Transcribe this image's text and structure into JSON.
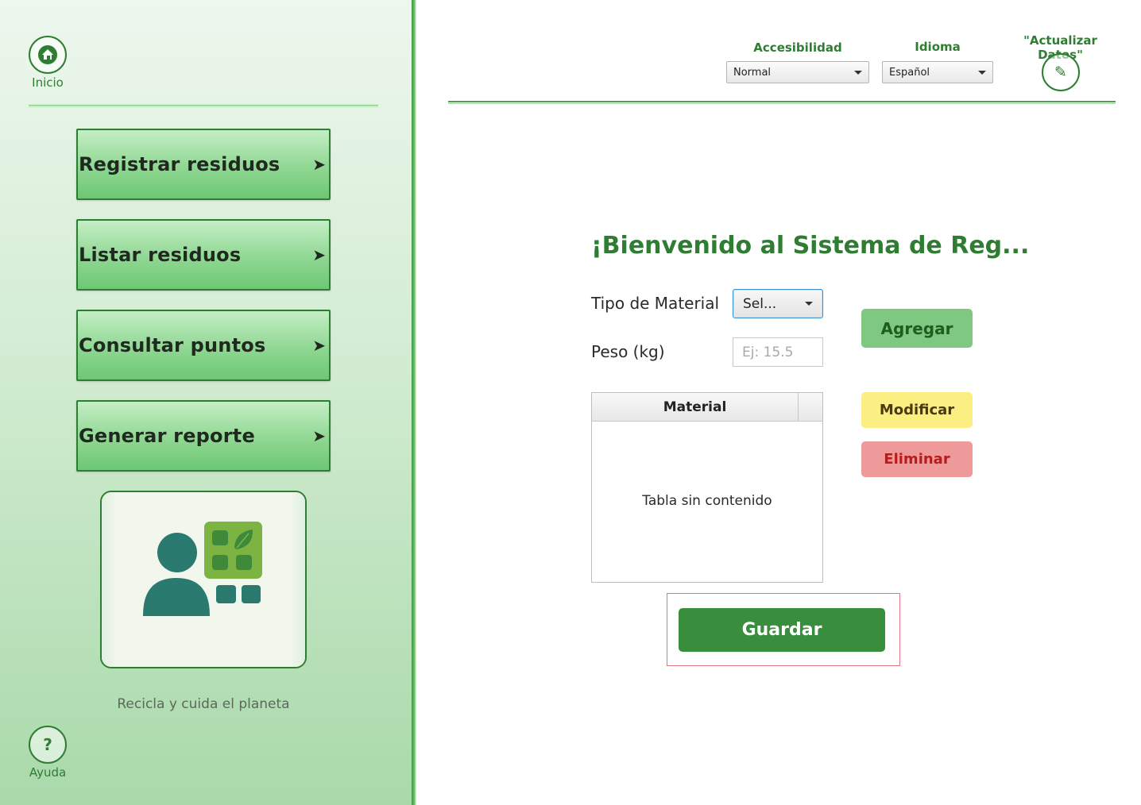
{
  "sidebar": {
    "home_caption": "Inicio",
    "help_symbol": "?",
    "help_caption": "Ayuda",
    "menu": [
      {
        "label": "Registrar residuos",
        "arrow": "➤"
      },
      {
        "label": "Listar residuos",
        "arrow": "➤"
      },
      {
        "label": "Consultar puntos",
        "arrow": "➤"
      },
      {
        "label": "Generar reporte",
        "arrow": "➤"
      }
    ],
    "tagline": "Recicla y cuida el planeta"
  },
  "header": {
    "accessibility_label": "Accesibilidad",
    "accessibility_value": "Normal",
    "language_label": "Idioma",
    "language_value": "Español",
    "update_label": "\"Actualizar Datos\"",
    "edit_icon": "✎"
  },
  "form": {
    "welcome": "¡Bienvenido al Sistema de Reg...",
    "material_label": "Tipo de Material",
    "material_value": "Sel...",
    "weight_label": "Peso (kg)",
    "weight_placeholder": "Ej: 15.5",
    "buttons": {
      "add": "Agregar",
      "modify": "Modificar",
      "delete": "Eliminar",
      "save": "Guardar"
    }
  },
  "table": {
    "columns": [
      "Material"
    ],
    "empty_text": "Tabla sin contenido"
  },
  "colors": {
    "brand_green": "#2e7d32",
    "add": "#7fc881",
    "modify": "#fbee82",
    "delete": "#ef9a9a",
    "save": "#388e3c"
  }
}
